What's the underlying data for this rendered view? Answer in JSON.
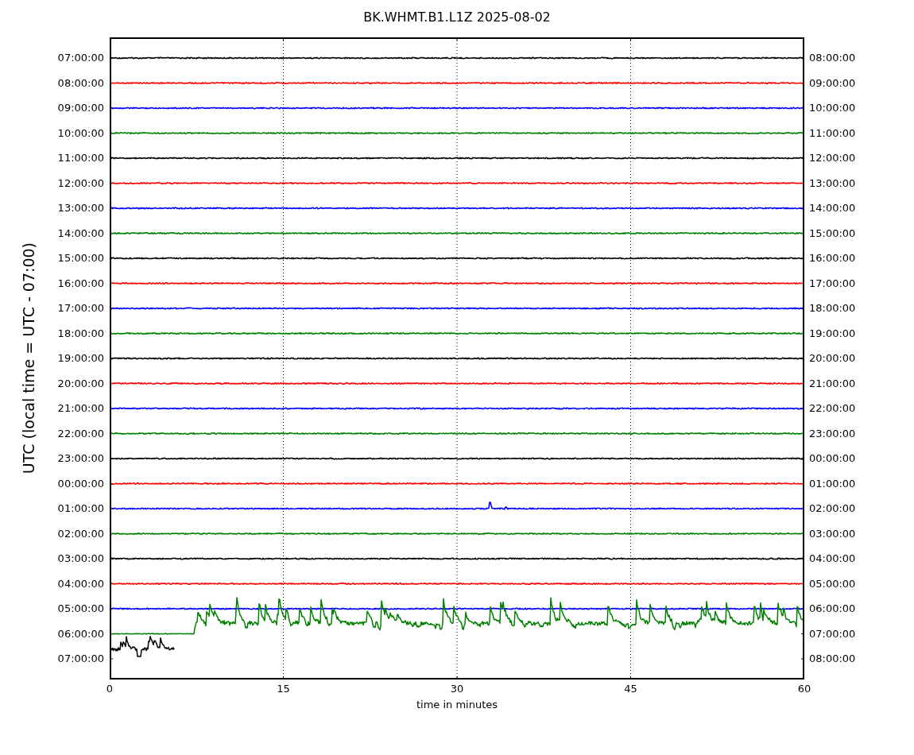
{
  "title": "BK.WHMT.B1.L1Z 2025-08-02",
  "ylabel": "UTC (local time = UTC - 07:00)",
  "xlabel": "time in minutes",
  "x_ticks": [
    "0",
    "15",
    "30",
    "45",
    "60"
  ],
  "rows": [
    {
      "left": "07:00:00",
      "right": "08:00:00",
      "color": "#000000",
      "kind": "quiet"
    },
    {
      "left": "08:00:00",
      "right": "09:00:00",
      "color": "#ff0000",
      "kind": "quiet"
    },
    {
      "left": "09:00:00",
      "right": "10:00:00",
      "color": "#0000ff",
      "kind": "quiet"
    },
    {
      "left": "10:00:00",
      "right": "11:00:00",
      "color": "#008000",
      "kind": "quiet"
    },
    {
      "left": "11:00:00",
      "right": "12:00:00",
      "color": "#000000",
      "kind": "quiet"
    },
    {
      "left": "12:00:00",
      "right": "13:00:00",
      "color": "#ff0000",
      "kind": "quiet"
    },
    {
      "left": "13:00:00",
      "right": "14:00:00",
      "color": "#0000ff",
      "kind": "quiet"
    },
    {
      "left": "14:00:00",
      "right": "15:00:00",
      "color": "#008000",
      "kind": "quiet"
    },
    {
      "left": "15:00:00",
      "right": "16:00:00",
      "color": "#000000",
      "kind": "quiet"
    },
    {
      "left": "16:00:00",
      "right": "17:00:00",
      "color": "#ff0000",
      "kind": "quiet"
    },
    {
      "left": "17:00:00",
      "right": "18:00:00",
      "color": "#0000ff",
      "kind": "quiet"
    },
    {
      "left": "18:00:00",
      "right": "19:00:00",
      "color": "#008000",
      "kind": "quiet"
    },
    {
      "left": "19:00:00",
      "right": "20:00:00",
      "color": "#000000",
      "kind": "quiet"
    },
    {
      "left": "20:00:00",
      "right": "21:00:00",
      "color": "#ff0000",
      "kind": "quiet"
    },
    {
      "left": "21:00:00",
      "right": "22:00:00",
      "color": "#0000ff",
      "kind": "quiet"
    },
    {
      "left": "22:00:00",
      "right": "23:00:00",
      "color": "#008000",
      "kind": "quiet"
    },
    {
      "left": "23:00:00",
      "right": "00:00:00",
      "color": "#000000",
      "kind": "quiet"
    },
    {
      "left": "00:00:00",
      "right": "01:00:00",
      "color": "#ff0000",
      "kind": "quiet"
    },
    {
      "left": "01:00:00",
      "right": "02:00:00",
      "color": "#0000ff",
      "kind": "spike"
    },
    {
      "left": "02:00:00",
      "right": "03:00:00",
      "color": "#008000",
      "kind": "quiet"
    },
    {
      "left": "03:00:00",
      "right": "04:00:00",
      "color": "#000000",
      "kind": "quiet"
    },
    {
      "left": "04:00:00",
      "right": "05:00:00",
      "color": "#ff0000",
      "kind": "quiet"
    },
    {
      "left": "05:00:00",
      "right": "06:00:00",
      "color": "#0000ff",
      "kind": "quiet"
    },
    {
      "left": "06:00:00",
      "right": "07:00:00",
      "color": "#008000",
      "kind": "burst"
    },
    {
      "left": "07:00:00",
      "right": "08:00:00",
      "color": "#000000",
      "kind": "partial"
    }
  ]
}
